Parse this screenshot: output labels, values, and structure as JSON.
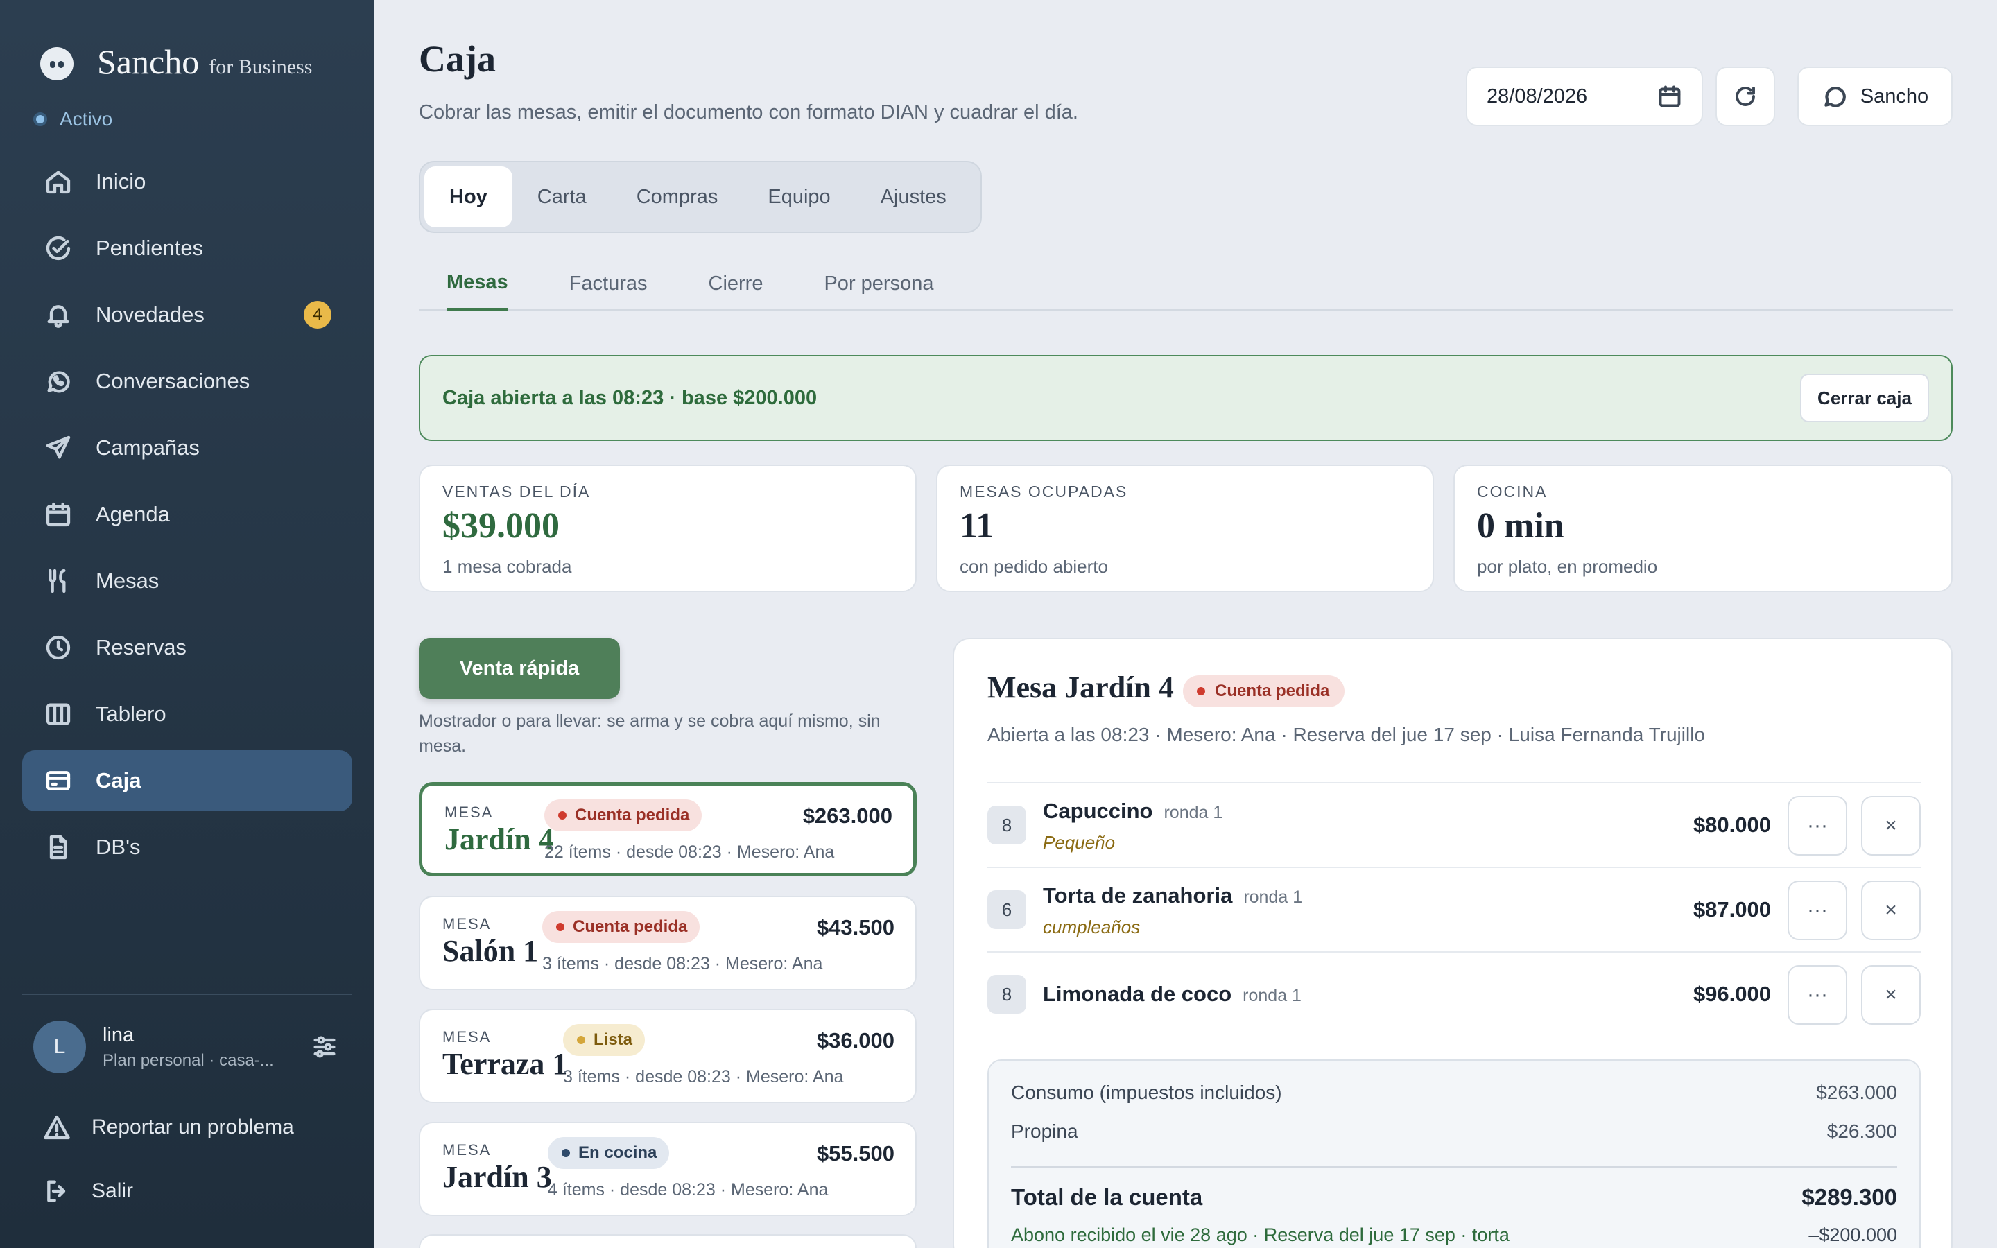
{
  "sidebar": {
    "brand_name": "Sancho",
    "brand_sub": "for Business",
    "status": "Activo",
    "items": [
      {
        "label": "Inicio",
        "icon": "home-icon"
      },
      {
        "label": "Pendientes",
        "icon": "check-circle-icon"
      },
      {
        "label": "Novedades",
        "icon": "bell-icon",
        "badge": "4"
      },
      {
        "label": "Conversaciones",
        "icon": "chat-icon"
      },
      {
        "label": "Campañas",
        "icon": "send-icon"
      },
      {
        "label": "Agenda",
        "icon": "calendar-icon"
      },
      {
        "label": "Mesas",
        "icon": "utensils-icon"
      },
      {
        "label": "Reservas",
        "icon": "clock-icon"
      },
      {
        "label": "Tablero",
        "icon": "columns-icon"
      },
      {
        "label": "Caja",
        "icon": "card-icon",
        "active": true
      },
      {
        "label": "DB's",
        "icon": "document-icon"
      }
    ],
    "user": {
      "initial": "L",
      "name": "lina",
      "plan": "Plan personal · casa-..."
    },
    "report_label": "Reportar un problema",
    "logout_label": "Salir"
  },
  "header": {
    "title": "Caja",
    "subtitle": "Cobrar las mesas, emitir el documento con formato DIAN y cuadrar el día.",
    "date_value": "28/08/2026",
    "sancho_label": "Sancho"
  },
  "tabs": [
    "Hoy",
    "Carta",
    "Compras",
    "Equipo",
    "Ajustes"
  ],
  "subtabs": [
    "Mesas",
    "Facturas",
    "Cierre",
    "Por persona"
  ],
  "banner": {
    "text": "Caja abierta a las 08:23 · base $200.000",
    "button": "Cerrar caja"
  },
  "kpis": [
    {
      "label": "VENTAS DEL DÍA",
      "value": "$39.000",
      "note": "1 mesa cobrada"
    },
    {
      "label": "MESAS OCUPADAS",
      "value": "11",
      "note": "con pedido abierto"
    },
    {
      "label": "COCINA",
      "value": "0 min",
      "note": "por plato, en promedio"
    }
  ],
  "quick_sale": {
    "button": "Venta rápida",
    "note": "Mostrador o para llevar: se arma y se cobra aquí mismo, sin mesa."
  },
  "tables": [
    {
      "mesa": "MESA",
      "name": "Jardín 4",
      "status": "Cuenta pedida",
      "amount": "$263.000",
      "meta": "22 ítems · desde 08:23 · Mesero: Ana"
    },
    {
      "mesa": "MESA",
      "name": "Salón 1",
      "status": "Cuenta pedida",
      "amount": "$43.500",
      "meta": "3 ítems · desde 08:23 · Mesero: Ana"
    },
    {
      "mesa": "MESA",
      "name": "Terraza 1",
      "status": "Lista",
      "amount": "$36.000",
      "meta": "3 ítems · desde 08:23 · Mesero: Ana"
    },
    {
      "mesa": "MESA",
      "name": "Jardín 3",
      "status": "En cocina",
      "amount": "$55.500",
      "meta": "4 ítems · desde 08:23 · Mesero: Ana"
    }
  ],
  "detail": {
    "title": "Mesa Jardín 4",
    "status": "Cuenta pedida",
    "subtitle": "Abierta a las 08:23 · Mesero: Ana · Reserva del jue 17 sep · Luisa Fernanda Trujillo",
    "lines": [
      {
        "qty": "8",
        "name": "Capuccino",
        "round": "ronda 1",
        "note": "Pequeño",
        "amount": "$80.000"
      },
      {
        "qty": "6",
        "name": "Torta de zanahoria",
        "round": "ronda 1",
        "note": "cumpleaños",
        "amount": "$87.000"
      },
      {
        "qty": "8",
        "name": "Limonada de coco",
        "round": "ronda 1",
        "note": "",
        "amount": "$96.000"
      }
    ],
    "more_glyph": "···",
    "remove_glyph": "×",
    "consumo_label": "Consumo (impuestos incluidos)",
    "consumo_value": "$263.000",
    "propina_label": "Propina",
    "propina_value": "$26.300",
    "total_label": "Total de la cuenta",
    "total_value": "$289.300",
    "abono_label": "Abono recibido el vie 28 ago · Reserva del jue 17 sep · torta",
    "abono_value": "–$200.000"
  }
}
